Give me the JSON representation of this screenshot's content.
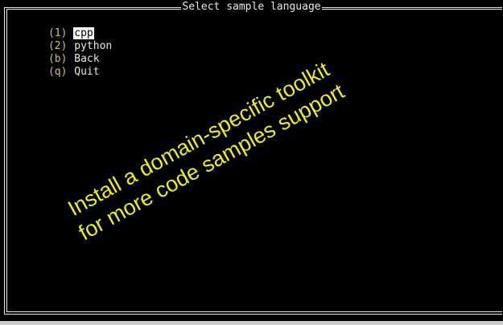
{
  "window": {
    "title": "Select sample language"
  },
  "menu": {
    "items": [
      {
        "key": "(1)",
        "label": "cpp",
        "selected": true
      },
      {
        "key": "(2)",
        "label": "python",
        "selected": false
      },
      {
        "key": "(b)",
        "label": "Back",
        "selected": false
      },
      {
        "key": "(q)",
        "label": "Quit",
        "selected": false
      }
    ]
  },
  "overlay": {
    "lines": [
      "Install a domain-specific toolkit",
      "for more code samples support"
    ]
  },
  "colors": {
    "background": "#000000",
    "text": "#e8e8e8",
    "key": "#d7c43a",
    "highlight_bg": "#ffffff",
    "overlay_text": "#ecec29"
  }
}
